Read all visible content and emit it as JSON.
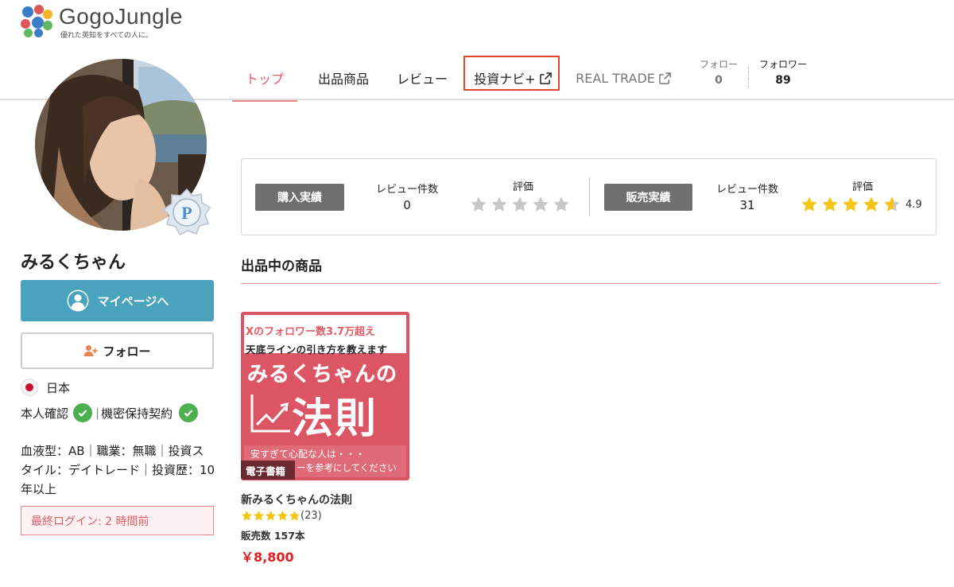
{
  "brand": {
    "name": "GogoJungle",
    "tagline": "優れた英知をすべての人に。"
  },
  "nav": {
    "items": [
      {
        "label": "トップ",
        "active": true
      },
      {
        "label": "出品商品"
      },
      {
        "label": "レビュー"
      },
      {
        "label": "投資ナビ+",
        "icon": "external-link-icon"
      },
      {
        "label": "REAL TRADE",
        "icon": "external-link-icon"
      }
    ]
  },
  "follow": {
    "following_label": "フォロー",
    "following_count": "0",
    "followers_label": "フォロワー",
    "followers_count": "89"
  },
  "profile": {
    "name": "みるくちゃん",
    "badge_letter": "P",
    "mypage_label": "マイページへ",
    "follow_label": "フォロー",
    "country": "日本",
    "verified_label": "本人確認",
    "nda_label": "機密保持契約",
    "bio": "血液型：AB｜職業：無職｜投資スタイル：デイトレード｜投資歴：10年以上",
    "last_login": "最終ログイン: 2 時間前"
  },
  "stats": {
    "purchase": {
      "tag": "購入実績",
      "review_count_label": "レビュー件数",
      "review_count": "0",
      "rating_label": "評価",
      "rating": 0
    },
    "sales": {
      "tag": "販売実績",
      "review_count_label": "レビュー件数",
      "review_count": "31",
      "rating_label": "評価",
      "rating": 4.9,
      "rating_text": "4.9"
    }
  },
  "listing": {
    "section_title": "出品中の商品",
    "products": [
      {
        "cover_line1": "Xのフォロワー数3.7万超え",
        "cover_line2": "天底ラインの引き方を教えます",
        "cover_title": "みるくちゃんの",
        "cover_title_big": "法則",
        "cover_sub1": "安すぎて心配な人は・・・",
        "cover_sub2": "ーを参考にしてください",
        "category_tag": "電子書籍",
        "name": "新みるくちゃんの法則",
        "rating": 5,
        "review_count": "(23)",
        "sales": "販売数 157本",
        "price": "￥8,800"
      }
    ]
  },
  "colors": {
    "accent": "#e05a63",
    "mypage_button": "#4aa3bd",
    "star_gold": "#f5c518",
    "star_gray": "#c8c8c8",
    "check_green": "#4caf50",
    "highlight_box": "#e24a2a"
  }
}
